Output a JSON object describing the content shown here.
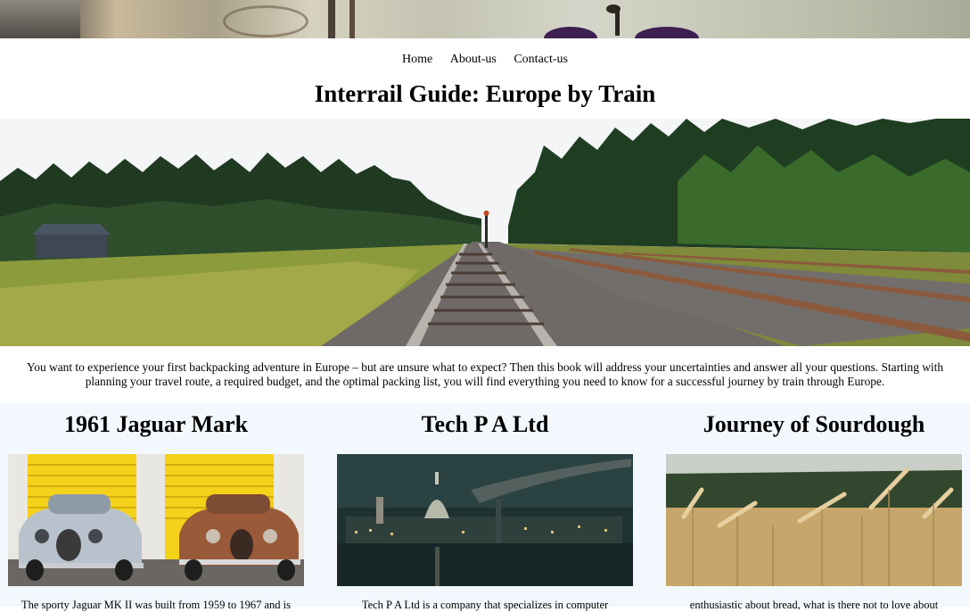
{
  "nav": {
    "items": [
      "Home",
      "About-us",
      "Contact-us"
    ]
  },
  "page_title": "Interrail Guide: Europe by Train",
  "intro": "You want to experience your first backpacking adventure in Europe – but are unsure what to expect? Then this book will address your uncertainties and answer all your questions. Starting with planning your travel route, a required budget, and the optimal packing list, you will find everything you need to know for a successful journey by train through Europe.",
  "cards": [
    {
      "title": "1961 Jaguar Mark",
      "text": "The sporty Jaguar MK II was built from 1959 to 1967 and is"
    },
    {
      "title": "Tech P A Ltd",
      "text": "Tech P A Ltd is a company that specializes in computer"
    },
    {
      "title": "Journey of Sourdough",
      "text": "enthusiastic about bread, what is there not to love about"
    }
  ]
}
